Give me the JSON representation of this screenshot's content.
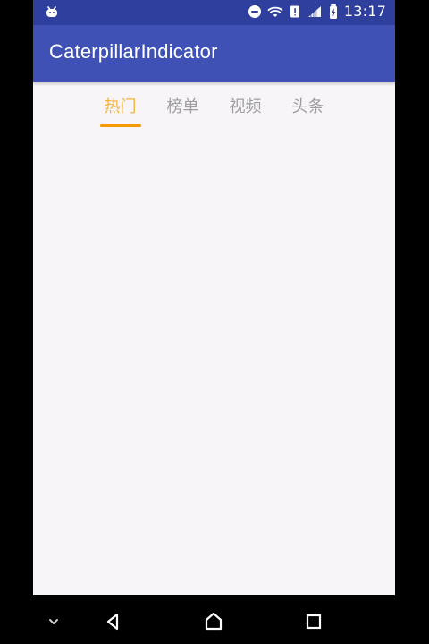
{
  "colors": {
    "status_bar": "#2f3f9d",
    "app_bar": "#3f51b5",
    "active_tab_text": "#f5b33a",
    "active_tab_indicator": "#f59a00",
    "inactive_tab_text": "#9e9e9e",
    "content_bg": "#f7f5f8",
    "nav_bar_bg": "#000000",
    "status_icons": "#ffffff"
  },
  "status_bar": {
    "time": "13:17",
    "icons": [
      "android-debug-icon",
      "do-not-disturb-icon",
      "wifi-icon",
      "no-sim-icon",
      "signal-icon",
      "battery-charging-icon"
    ]
  },
  "app_bar": {
    "title": "CaterpillarIndicator"
  },
  "tabs": {
    "items": [
      {
        "label": "热门",
        "active": true
      },
      {
        "label": "榜单",
        "active": false
      },
      {
        "label": "视频",
        "active": false
      },
      {
        "label": "头条",
        "active": false
      }
    ]
  },
  "nav_bar": {
    "buttons": [
      "chevron-down-icon",
      "back-icon",
      "home-icon",
      "recents-icon"
    ]
  }
}
